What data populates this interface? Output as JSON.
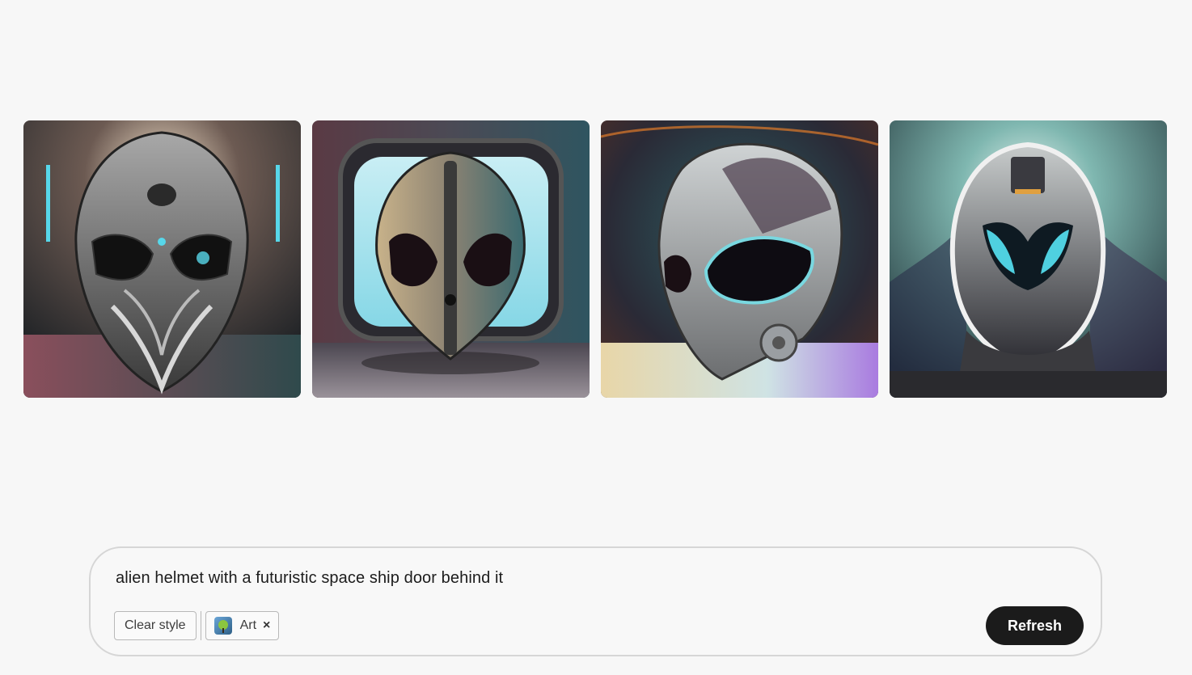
{
  "gallery": {
    "images": [
      {
        "alt_icon": "alien-helmet-image",
        "accent": "#5fd6e8",
        "bg": "#2a2a30"
      },
      {
        "alt_icon": "alien-helmet-image",
        "accent": "#8ee6f0",
        "bg": "#3a2f35"
      },
      {
        "alt_icon": "alien-helmet-image",
        "accent": "#79d8e0",
        "bg": "#3b2a28"
      },
      {
        "alt_icon": "alien-helmet-image",
        "accent": "#4fd0e0",
        "bg": "#1e2a2e"
      }
    ]
  },
  "prompt": {
    "text": "alien helmet with a futuristic space ship door behind it",
    "clear_style_label": "Clear style",
    "style_chip_label": "Art",
    "style_chip_remove": "×",
    "refresh_label": "Refresh"
  },
  "colors": {
    "page_bg": "#f7f7f7",
    "button_bg": "#1b1b1b",
    "button_text": "#ffffff"
  }
}
